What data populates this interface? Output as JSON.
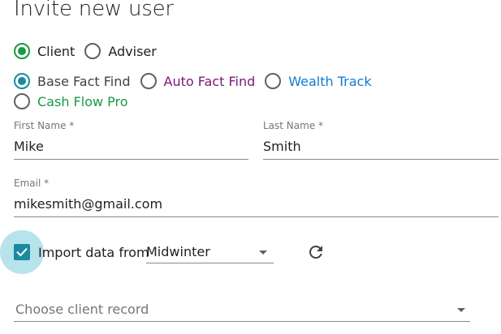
{
  "page": {
    "title": "Invite new user"
  },
  "user_type": {
    "options": [
      {
        "label": "Client",
        "selected": true
      },
      {
        "label": "Adviser",
        "selected": false
      }
    ]
  },
  "product": {
    "options": [
      {
        "label": "Base Fact Find",
        "selected": true,
        "color": "#424242"
      },
      {
        "label": "Auto Fact Find",
        "selected": false,
        "color": "#7b1677"
      },
      {
        "label": "Wealth Track",
        "selected": false,
        "color": "#1479d4"
      },
      {
        "label": "Cash Flow Pro",
        "selected": false,
        "color": "#1a9a43"
      }
    ]
  },
  "form": {
    "first_name": {
      "label": "First Name *",
      "value": "Mike"
    },
    "last_name": {
      "label": "Last Name *",
      "value": "Smith"
    },
    "email": {
      "label": "Email *",
      "value": "mikesmith@gmail.com"
    },
    "import": {
      "checked": true,
      "label": "Import data from",
      "source": "Midwinter"
    },
    "client_record": {
      "placeholder": "Choose client record"
    }
  },
  "colors": {
    "accent_teal": "#1b8aa0",
    "accent_green": "#1a9a43"
  },
  "icons": {
    "refresh": "refresh-icon",
    "dropdown": "arrow-drop-down-icon",
    "check": "check-icon"
  }
}
